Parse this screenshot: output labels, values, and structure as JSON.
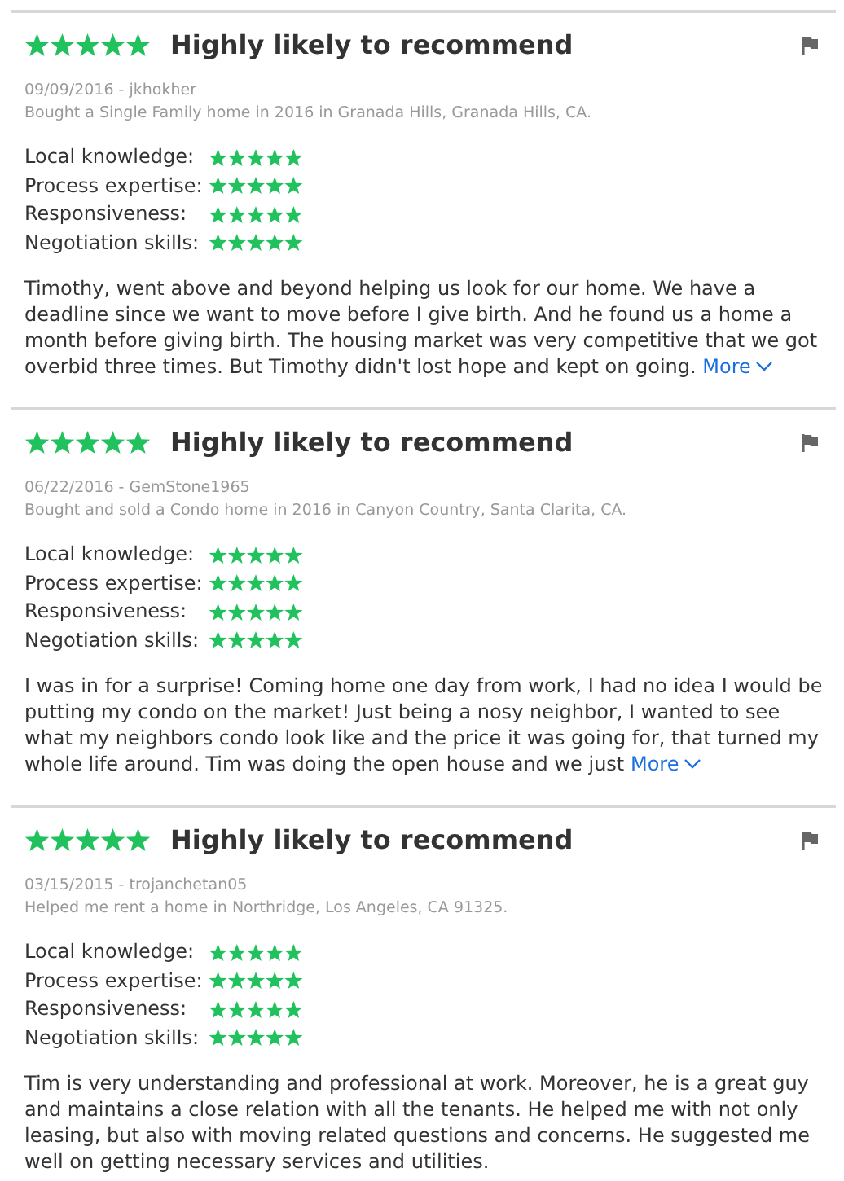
{
  "reviews": [
    {
      "stars": 5,
      "headline": "Highly likely to recommend",
      "byline": "09/09/2016 - jkhokher",
      "transaction": "Bought a Single Family home in 2016 in Granada Hills, Granada Hills, CA.",
      "ratings": [
        {
          "label": "Local knowledge:",
          "stars": 5
        },
        {
          "label": "Process expertise:",
          "stars": 5
        },
        {
          "label": "Responsiveness:",
          "stars": 5
        },
        {
          "label": "Negotiation skills:",
          "stars": 5
        }
      ],
      "body": "Timothy, went above and beyond helping us look for our home. We have a deadline since we want to move before I give birth. And he found us a home a month before giving birth. The housing market was very competitive that we got overbid three times. But Timothy didn't lost hope and kept on going.",
      "more": "More"
    },
    {
      "stars": 5,
      "headline": "Highly likely to recommend",
      "byline": "06/22/2016 - GemStone1965",
      "transaction": "Bought and sold a Condo home in 2016 in Canyon Country, Santa Clarita, CA.",
      "ratings": [
        {
          "label": "Local knowledge:",
          "stars": 5
        },
        {
          "label": "Process expertise:",
          "stars": 5
        },
        {
          "label": "Responsiveness:",
          "stars": 5
        },
        {
          "label": "Negotiation skills:",
          "stars": 5
        }
      ],
      "body": "I was in for a surprise! Coming home one day from work, I had no idea I would be putting my condo on the market! Just being a nosy neighbor, I wanted to see what my neighbors condo look like and the price it was going for, that turned my whole life around. Tim was doing the open house and we just",
      "more": "More"
    },
    {
      "stars": 5,
      "headline": "Highly likely to recommend",
      "byline": "03/15/2015 - trojanchetan05",
      "transaction": "Helped me rent a home in Northridge, Los Angeles, CA 91325.",
      "ratings": [
        {
          "label": "Local knowledge:",
          "stars": 5
        },
        {
          "label": "Process expertise:",
          "stars": 5
        },
        {
          "label": "Responsiveness:",
          "stars": 5
        },
        {
          "label": "Negotiation skills:",
          "stars": 5
        }
      ],
      "body": "Tim is very understanding and professional at work. Moreover, he is a great guy and maintains a close relation with all the tenants. He helped me with not only leasing, but also with moving related questions and concerns. He suggested me well on getting necessary services and utilities."
    }
  ]
}
